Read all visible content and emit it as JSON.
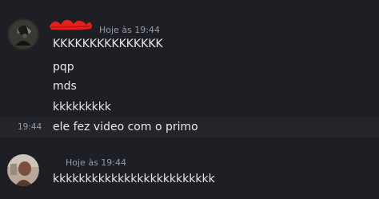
{
  "group1": {
    "avatar_icon": "user-avatar-dark",
    "timestamp": "Hoje às 19:44",
    "messages": [
      "KKKKKKKKKKKKKKK",
      "pqp",
      "mds",
      "kkkkkkkkk",
      "ele fez video com o primo"
    ],
    "hover_time": "19:44"
  },
  "group2": {
    "avatar_icon": "user-avatar-photo",
    "timestamp": "Hoje às 19:44",
    "messages": [
      "kkkkkkkkkkkkkkkkkkkkkkkkk"
    ]
  },
  "colors": {
    "background": "#1e1f24",
    "hover_row": "#24252a",
    "redaction": "#e5201a",
    "timestamp": "#949ba4",
    "text": "#e6e8ea"
  }
}
